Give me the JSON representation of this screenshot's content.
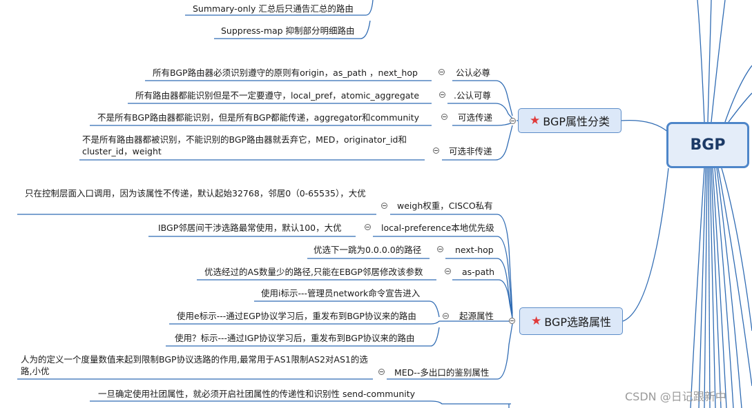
{
  "root": {
    "label": "BGP"
  },
  "top_items": [
    "Summary-only 汇总后只通告汇总的路由",
    "Suppress-map 抑制部分明细路由"
  ],
  "attr_classes": {
    "label": "BGP属性分类",
    "children": [
      {
        "label": "公认必尊",
        "desc": "所有BGP路由器必须识别遵守的原则有origin，as_path ，next_hop"
      },
      {
        "label": ".公认可尊",
        "desc": "所有路由器都能识别但是不一定要遵守，local_pref，atomic_aggregate"
      },
      {
        "label": "可选传递",
        "desc": "不是所有BGP路由器都能识别，但是所有BGP都能传递，aggregator和community"
      },
      {
        "label": "可选非传递",
        "desc": "不是所有路由器都被识别，不能识别的BGP路由器就丢弃它，MED，originator_id和cluster_id，weight"
      }
    ]
  },
  "path_attrs": {
    "label": "BGP选路属性",
    "children": [
      {
        "label": "weigh权重，CISCO私有",
        "desc": "只在控制层面入口调用，因为该属性不传递，默认起始32768，邻居0（0-65535），大优"
      },
      {
        "label": "local-preference本地优先级",
        "desc": "IBGP邻居间干涉选路最常使用，默认100，大优"
      },
      {
        "label": "next-hop",
        "desc": "优选下一跳为0.0.0.0的路径"
      },
      {
        "label": "as-path",
        "desc": "优选经过的AS数量少的路径,只能在EBGP邻居修改该参数"
      },
      {
        "label": "起源属性",
        "subs": [
          "使用i标示---管理员network命令宣告进入",
          "使用e标示---通过EGP协议学习后，重发布到BGP协议来的路由",
          "使用？标示---通过IGP协议学习后，重发布到BGP协议来的路由"
        ]
      },
      {
        "label": "MED--多出口的鉴别属性",
        "desc": "人为的定义一个度量数值来起到限制BGP协议选路的作用,最常用于AS1限制AS2对AS1的选路,小优"
      },
      {
        "label": "",
        "desc": "一旦确定使用社团属性，就必须开启社团属性的传递性和识别性 send-community"
      }
    ]
  },
  "watermark": "CSDN @日记跟新中",
  "colors": {
    "line": "#2f6bb3",
    "topic_fill": "#dce8f8",
    "topic_border": "#5b8cc8",
    "star": "#e03a3a"
  }
}
